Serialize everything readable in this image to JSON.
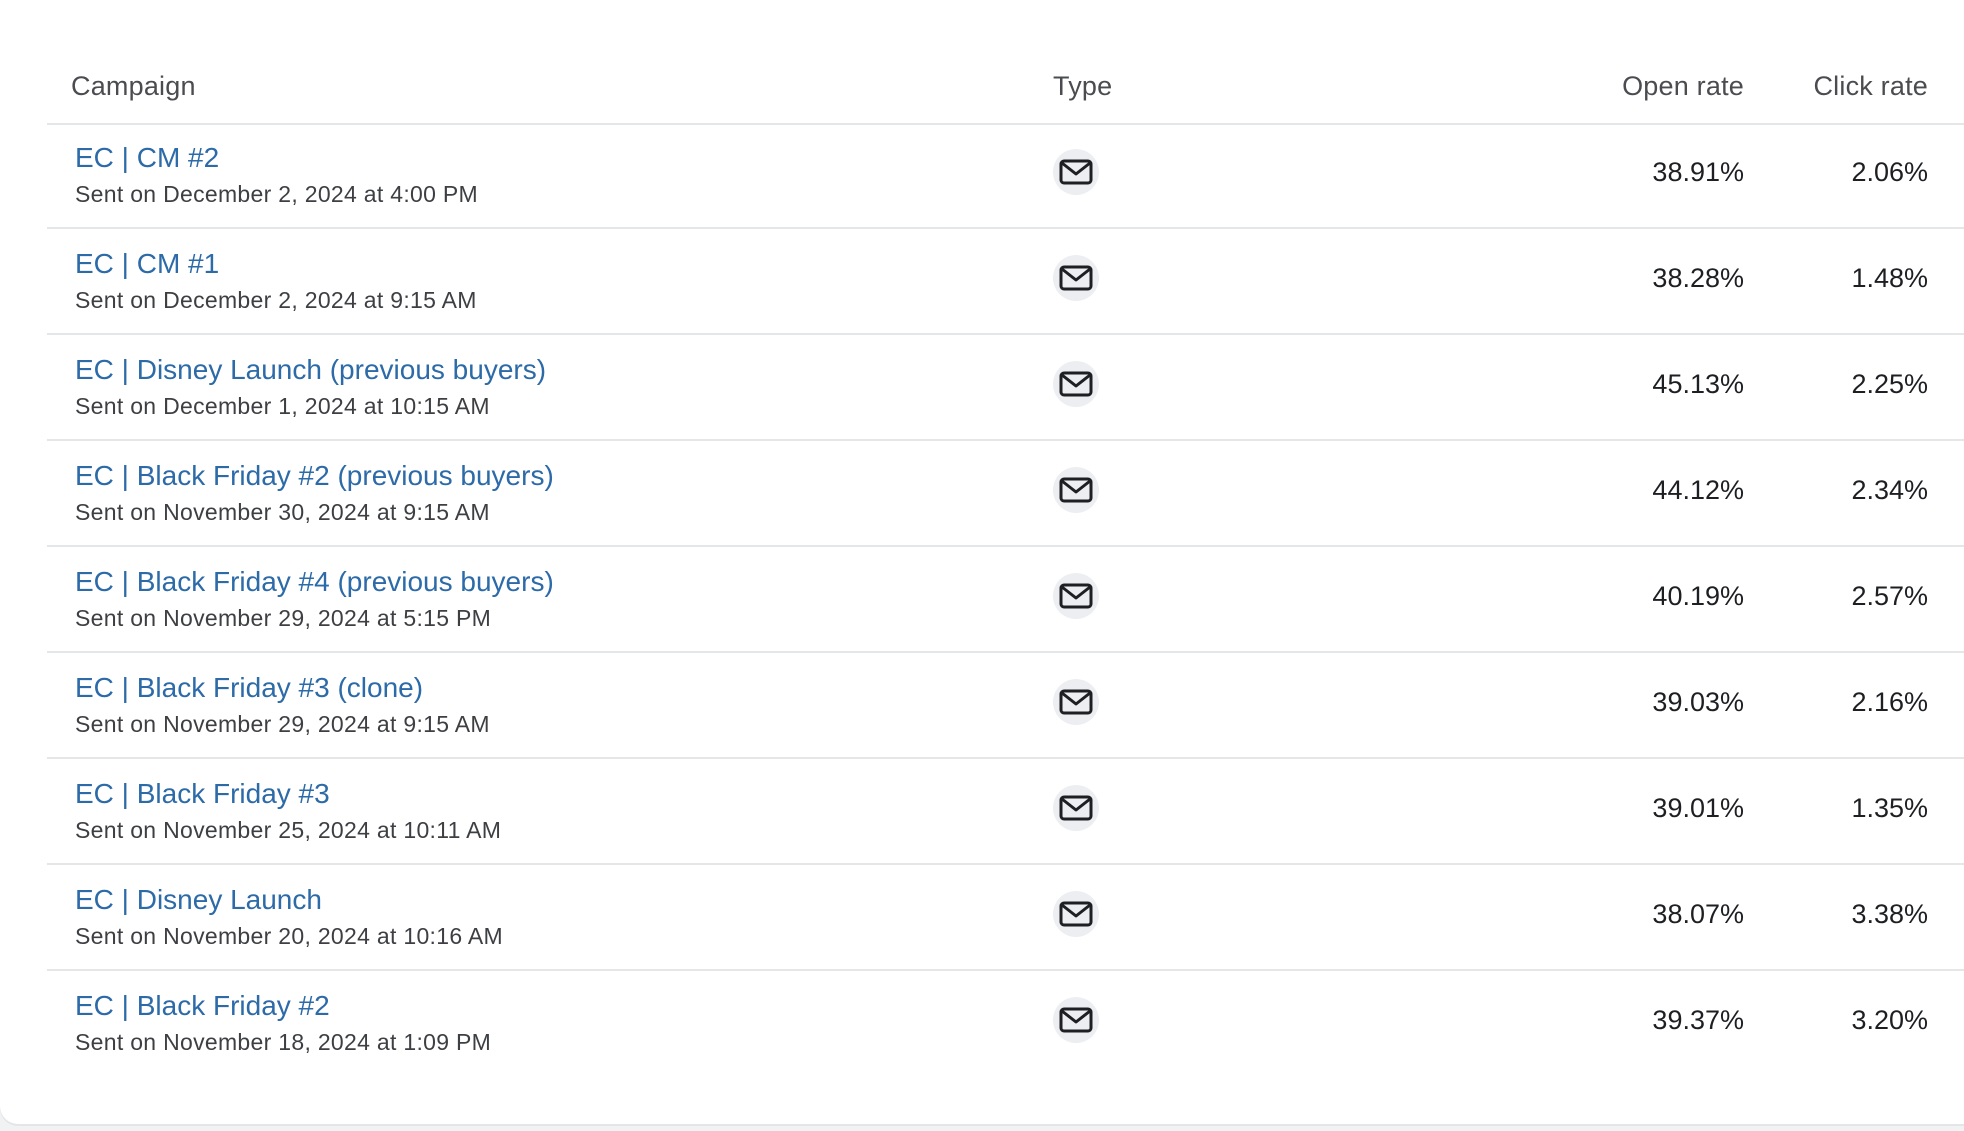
{
  "table": {
    "columns": {
      "campaign": "Campaign",
      "type": "Type",
      "open_rate": "Open rate",
      "click_rate": "Click rate"
    },
    "rows": [
      {
        "name": "EC | CM #2",
        "sent": "Sent on December 2, 2024 at 4:00 PM",
        "type_icon": "mail-icon",
        "open_rate": "38.91%",
        "click_rate": "2.06%"
      },
      {
        "name": "EC | CM #1",
        "sent": "Sent on December 2, 2024 at 9:15 AM",
        "type_icon": "mail-icon",
        "open_rate": "38.28%",
        "click_rate": "1.48%"
      },
      {
        "name": "EC | Disney Launch (previous buyers)",
        "sent": "Sent on December 1, 2024 at 10:15 AM",
        "type_icon": "mail-icon",
        "open_rate": "45.13%",
        "click_rate": "2.25%"
      },
      {
        "name": "EC | Black Friday #2 (previous buyers)",
        "sent": "Sent on November 30, 2024 at 9:15 AM",
        "type_icon": "mail-icon",
        "open_rate": "44.12%",
        "click_rate": "2.34%"
      },
      {
        "name": "EC | Black Friday #4 (previous buyers)",
        "sent": "Sent on November 29, 2024 at 5:15 PM",
        "type_icon": "mail-icon",
        "open_rate": "40.19%",
        "click_rate": "2.57%"
      },
      {
        "name": "EC | Black Friday #3 (clone)",
        "sent": "Sent on November 29, 2024 at 9:15 AM",
        "type_icon": "mail-icon",
        "open_rate": "39.03%",
        "click_rate": "2.16%"
      },
      {
        "name": "EC | Black Friday #3",
        "sent": "Sent on November 25, 2024 at 10:11 AM",
        "type_icon": "mail-icon",
        "open_rate": "39.01%",
        "click_rate": "1.35%"
      },
      {
        "name": "EC | Disney Launch",
        "sent": "Sent on November 20, 2024 at 10:16 AM",
        "type_icon": "mail-icon",
        "open_rate": "38.07%",
        "click_rate": "3.38%"
      },
      {
        "name": "EC | Black Friday #2",
        "sent": "Sent on November 18, 2024 at 1:09 PM",
        "type_icon": "mail-icon",
        "open_rate": "39.37%",
        "click_rate": "3.20%"
      }
    ]
  },
  "colors": {
    "link": "#2c6aa8",
    "text": "#1d1f23",
    "muted": "#3d3f43",
    "divider": "#e5e6e8",
    "icon_bg": "#eceef1"
  }
}
